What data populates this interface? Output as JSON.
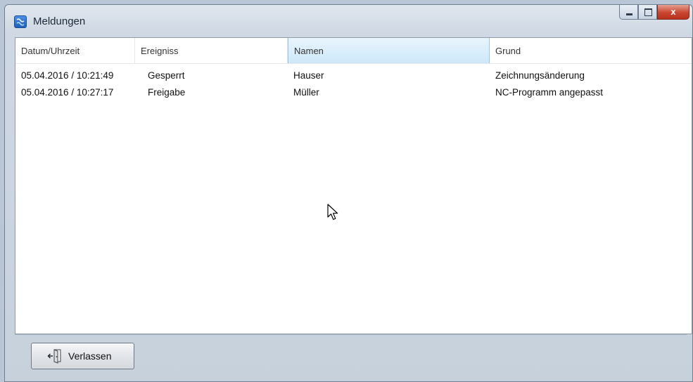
{
  "window": {
    "title": "Meldungen"
  },
  "caption": {
    "close_glyph": "x"
  },
  "table": {
    "columns": [
      "Datum/Uhrzeit",
      "Ereigniss",
      "Namen",
      "Grund"
    ],
    "sorted_column": "Namen",
    "rows": [
      [
        "05.04.2016 / 10:21:49",
        "Gesperrt",
        "Hauser",
        "Zeichnungsänderung"
      ],
      [
        "05.04.2016 / 10:27:17",
        "Freigabe",
        "Müller",
        "NC-Programm angepasst"
      ]
    ]
  },
  "footer": {
    "exit_label": "Verlassen"
  },
  "colors": {
    "active_header": "#cde8f9",
    "close_button": "#c9452f"
  },
  "icons": {
    "app": "app-icon",
    "exit": "door-exit-icon",
    "pointer": "mouse-pointer-icon"
  }
}
